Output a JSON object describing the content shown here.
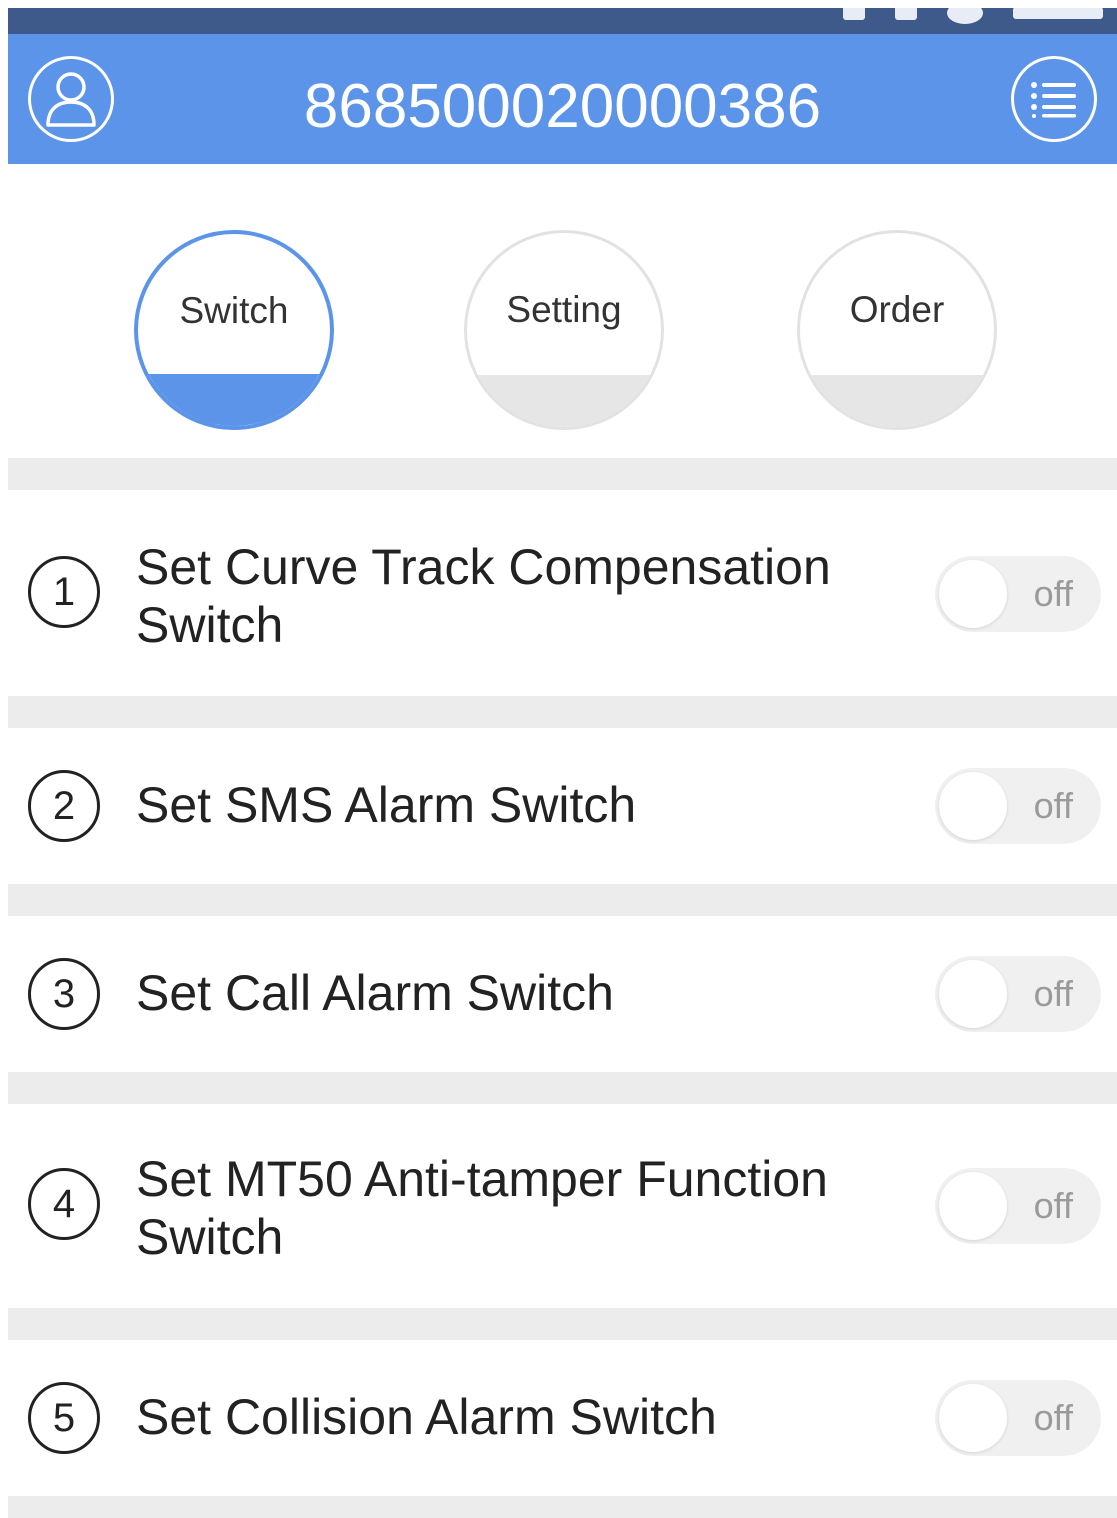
{
  "header": {
    "title": "868500020000386",
    "profile_icon": "user-icon",
    "menu_icon": "list-menu-icon",
    "color": "#5b94e8"
  },
  "status_bar": {
    "color": "#3d5a8a"
  },
  "tabs": [
    {
      "label": "Switch",
      "active": true
    },
    {
      "label": "Setting",
      "active": false
    },
    {
      "label": "Order",
      "active": false
    }
  ],
  "items": [
    {
      "number": "1",
      "label_line1": "Set Curve Track Compensation",
      "label_line2": "Switch",
      "state": "off"
    },
    {
      "number": "2",
      "label_line1": "Set SMS Alarm Switch",
      "label_line2": "",
      "state": "off"
    },
    {
      "number": "3",
      "label_line1": "Set Call Alarm Switch",
      "label_line2": "",
      "state": "off"
    },
    {
      "number": "4",
      "label_line1": "Set MT50 Anti-tamper Function",
      "label_line2": "Switch",
      "state": "off"
    },
    {
      "number": "5",
      "label_line1": "Set Collision Alarm Switch",
      "label_line2": "",
      "state": "off"
    }
  ]
}
